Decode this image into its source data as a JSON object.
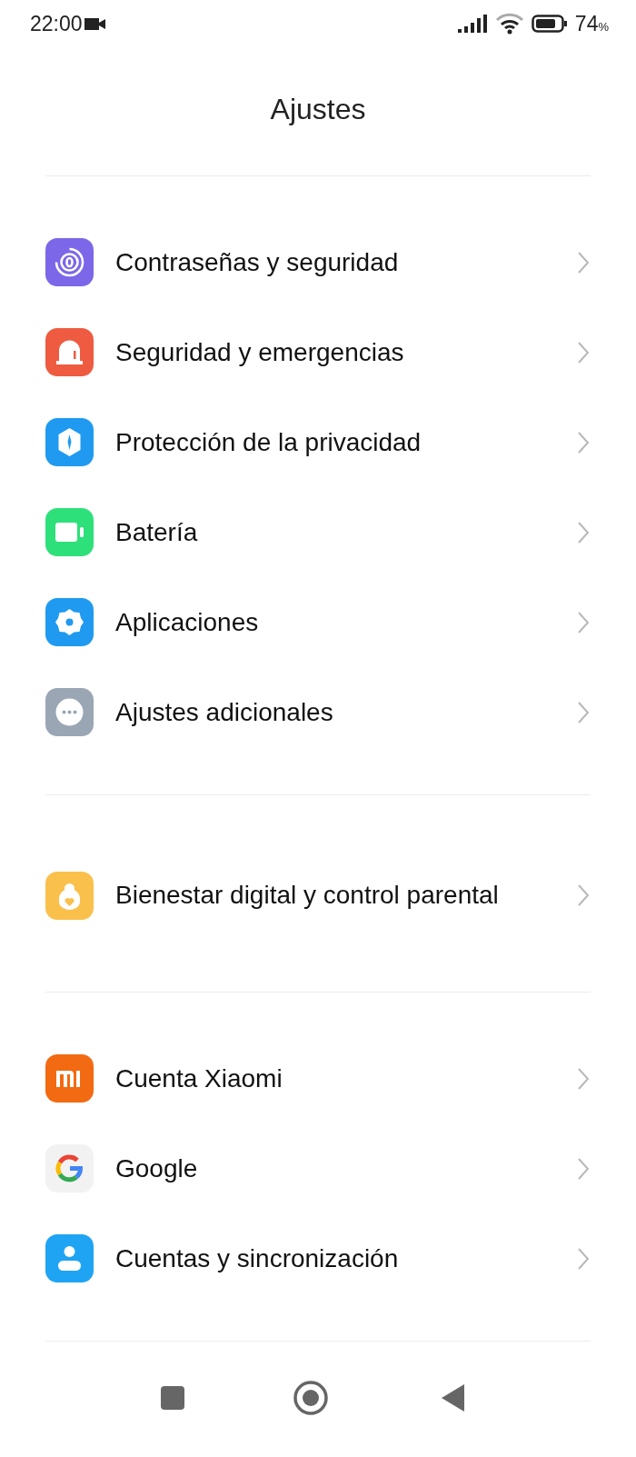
{
  "status_bar": {
    "time": "22:00",
    "battery_text": "74",
    "battery_unit": "%"
  },
  "title": "Ajustes",
  "sections": [
    {
      "items": [
        {
          "label": "Contraseñas y seguridad"
        },
        {
          "label": "Seguridad y emergencias"
        },
        {
          "label": "Protección de la privacidad"
        },
        {
          "label": "Batería"
        },
        {
          "label": "Aplicaciones"
        },
        {
          "label": "Ajustes adicionales"
        }
      ]
    },
    {
      "items": [
        {
          "label": "Bienestar digital y control parental"
        }
      ]
    },
    {
      "items": [
        {
          "label": "Cuenta Xiaomi"
        },
        {
          "label": "Google"
        },
        {
          "label": "Cuentas y sincronización"
        }
      ]
    }
  ]
}
